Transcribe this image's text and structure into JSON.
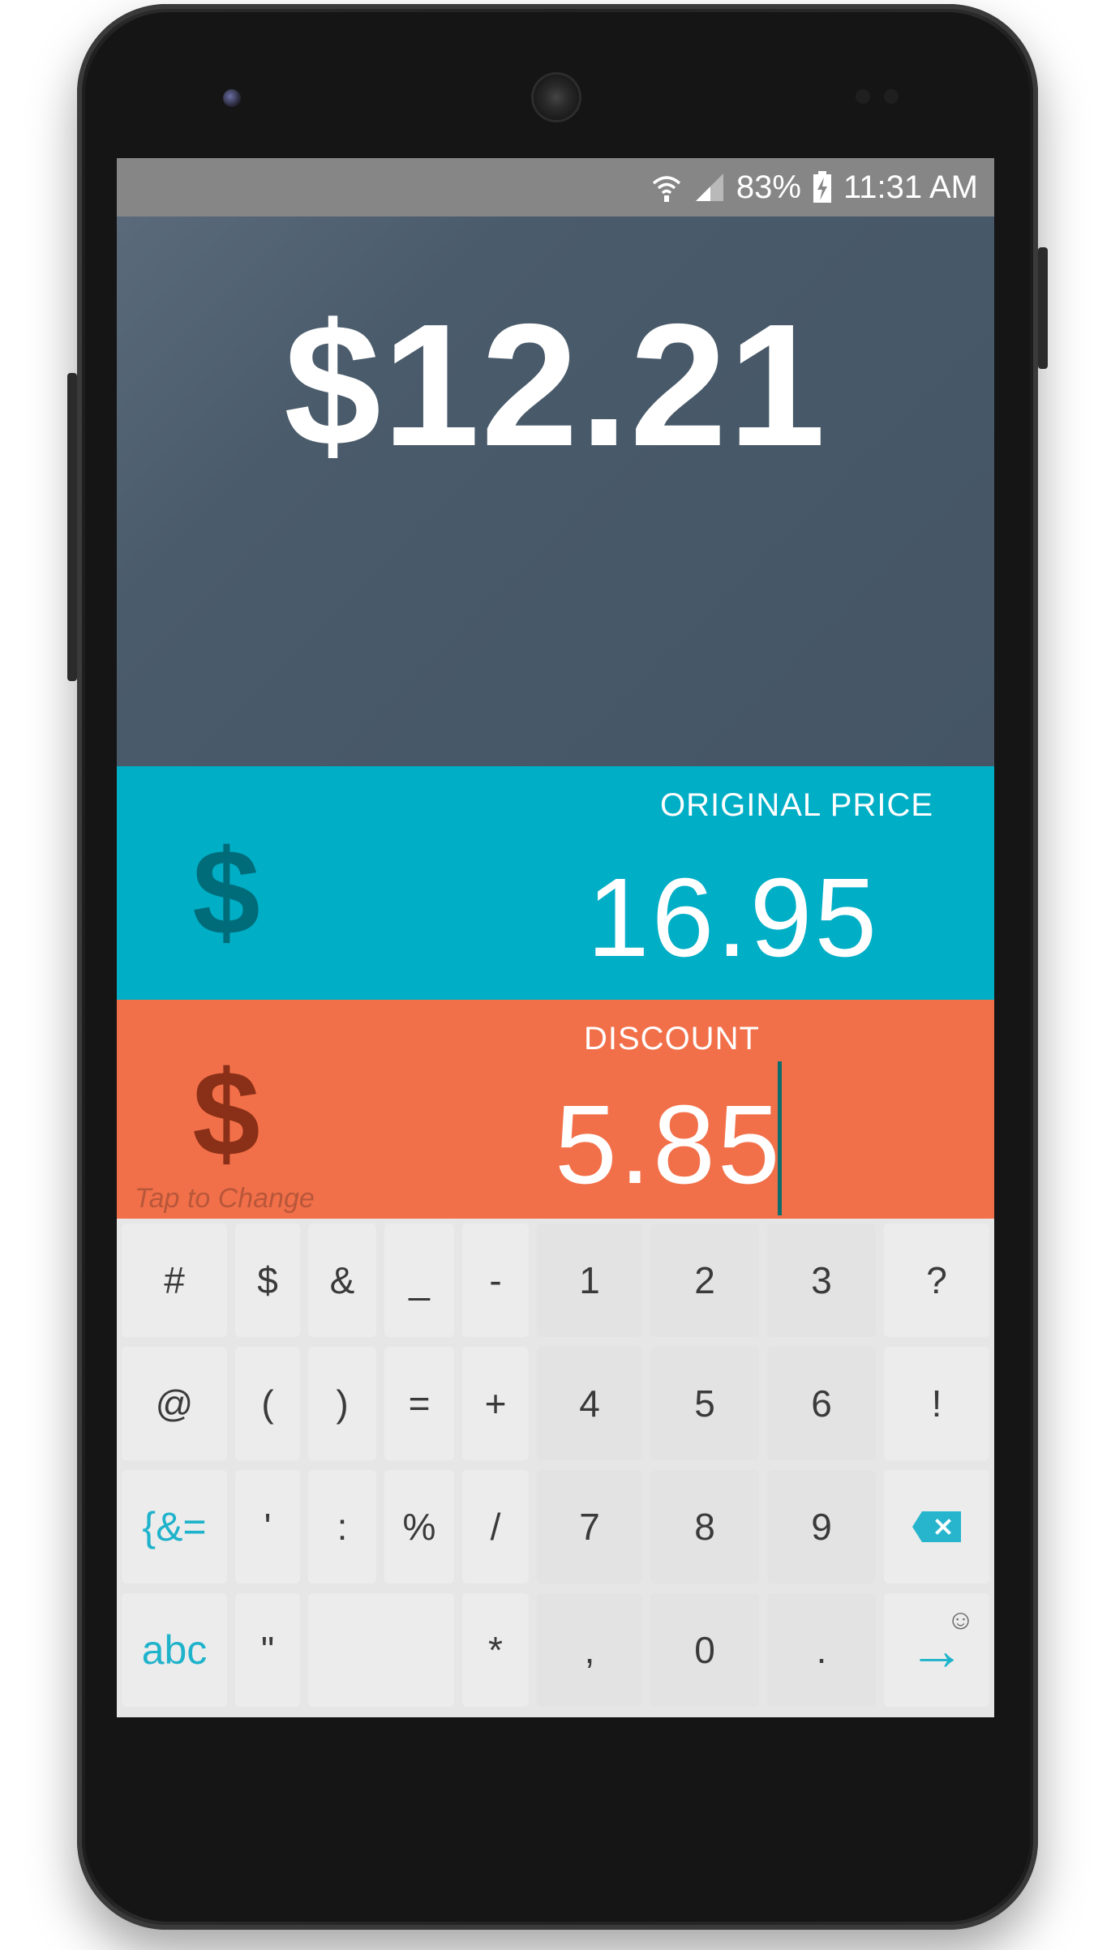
{
  "status_bar": {
    "battery": "83%",
    "time": "11:31 AM",
    "wifi_icon": "wifi-icon",
    "signal_icon": "signal-icon",
    "battery_icon": "battery-charging-icon"
  },
  "result": {
    "amount": "$12.21"
  },
  "fields": {
    "original_price": {
      "label": "ORIGINAL PRICE",
      "value": "16.95",
      "currency": "$"
    },
    "discount": {
      "label": "DISCOUNT",
      "value": "5.85",
      "currency": "$",
      "hint": "Tap to Change"
    }
  },
  "keyboard": {
    "rows": [
      [
        "#",
        "$",
        "&",
        "_",
        "-",
        "1",
        "2",
        "3",
        "?"
      ],
      [
        "@",
        "(",
        ")",
        "=",
        "+",
        "4",
        "5",
        "6",
        "!"
      ],
      [
        "{&=",
        "'",
        ":",
        "%",
        "/",
        "7",
        "8",
        "9",
        ""
      ],
      [
        "abc",
        "\"",
        "",
        "*",
        ",",
        "0",
        ".",
        ""
      ]
    ],
    "emoji_glyph": "☺",
    "enter_glyph": "→"
  },
  "colors": {
    "price_bg": "#00aec6",
    "discount_bg": "#f27049",
    "result_bg": "#475868",
    "accent": "#1fb3cb"
  }
}
